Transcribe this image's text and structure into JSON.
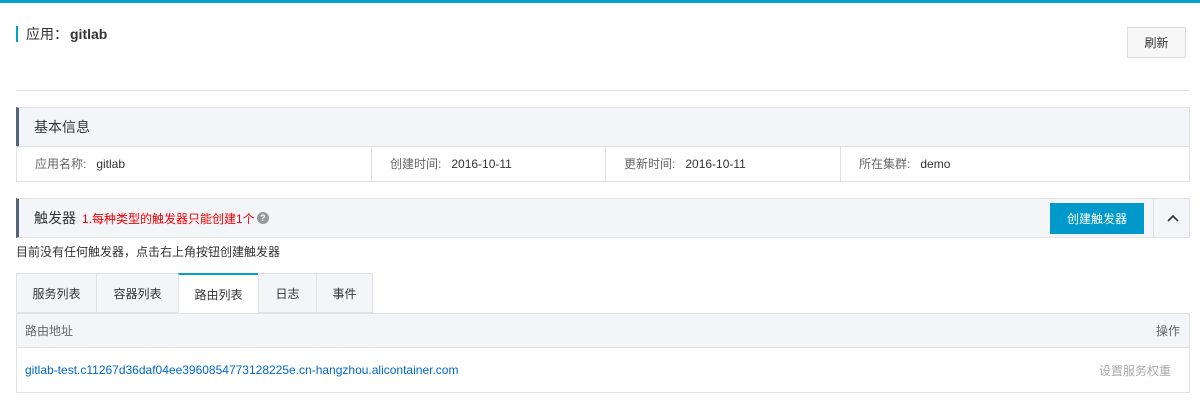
{
  "app": {
    "label": "应用：",
    "name": "gitlab"
  },
  "toolbar": {
    "refresh_label": "刷新"
  },
  "basic_info": {
    "title": "基本信息",
    "fields": [
      {
        "label": "应用名称:",
        "value": "gitlab"
      },
      {
        "label": "创建时间:",
        "value": "2016-10-11"
      },
      {
        "label": "更新时间:",
        "value": "2016-10-11"
      },
      {
        "label": "所在集群:",
        "value": "demo"
      }
    ]
  },
  "trigger": {
    "title": "触发器",
    "note": "1.每种类型的触发器只能创建1个",
    "help_icon": "question-circle-icon",
    "create_label": "创建触发器",
    "collapse_icon": "chevron-up-icon",
    "empty_message": "目前没有任何触发器，点击右上角按钮创建触发器"
  },
  "tabs": [
    {
      "label": "服务列表",
      "active": false
    },
    {
      "label": "容器列表",
      "active": false
    },
    {
      "label": "路由列表",
      "active": true
    },
    {
      "label": "日志",
      "active": false
    },
    {
      "label": "事件",
      "active": false
    }
  ],
  "routes_table": {
    "headers": {
      "address": "路由地址",
      "actions": "操作"
    },
    "rows": [
      {
        "address": "gitlab-test.c11267d36daf04ee3960854773128225e.cn-hangzhou.alicontainer.com",
        "action": "设置服务权重"
      }
    ]
  },
  "colors": {
    "accent": "#00a2ca",
    "primary_button": "#0099cc",
    "link": "#0066cc",
    "warning_text": "#ee0000"
  }
}
